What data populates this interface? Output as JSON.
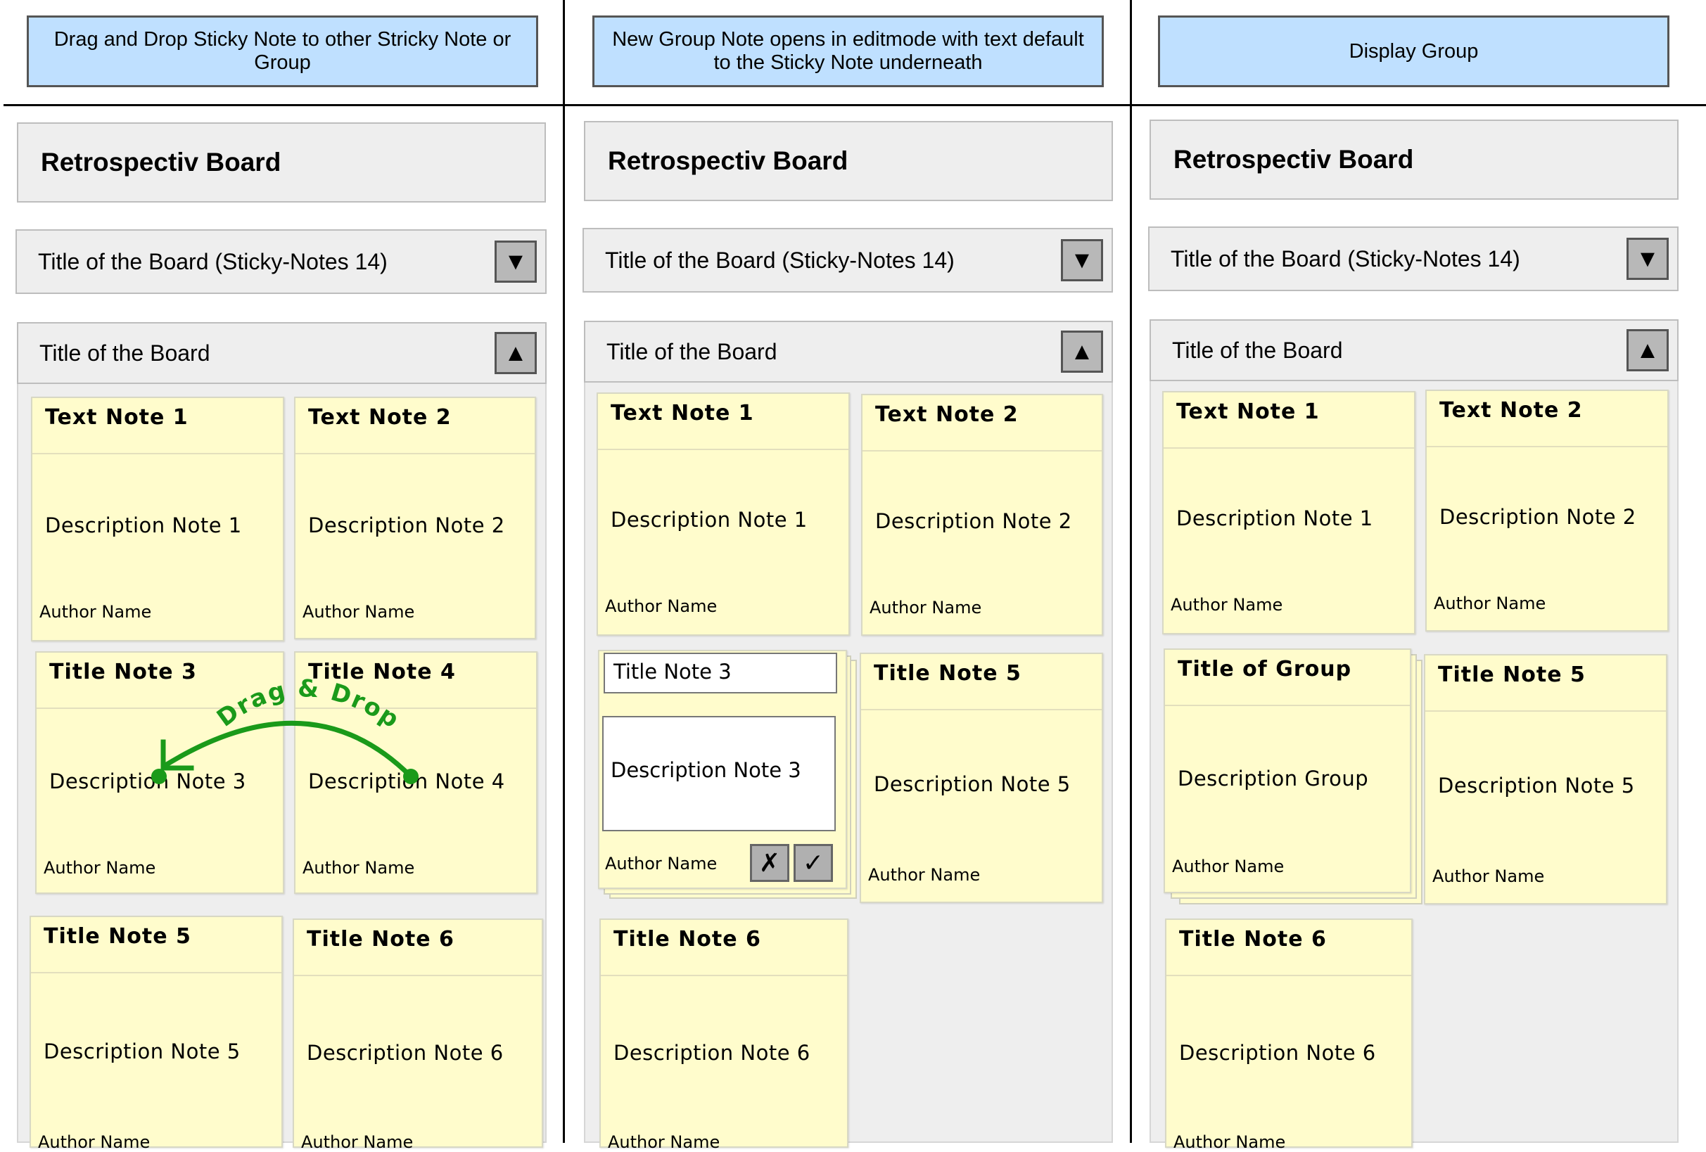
{
  "steps": [
    {
      "caption": "Drag and Drop Sticky Note to other Stricky Note or Group"
    },
    {
      "caption": "New Group Note opens in editmode with text default to the Sticky Note underneath"
    },
    {
      "caption": "Display Group"
    }
  ],
  "app": {
    "title": "Retrospectiv Board"
  },
  "board_collapsed": {
    "title": "Title of the Board (Sticky-Notes 14)",
    "toggle_icon": "▼"
  },
  "board_expanded": {
    "title": "Title of the Board",
    "toggle_icon": "▲"
  },
  "author": "Author Name",
  "panel1": {
    "notes": [
      {
        "title": "Text Note 1",
        "desc": "Description Note 1"
      },
      {
        "title": "Text Note 2",
        "desc": "Description Note 2"
      },
      {
        "title": "Title Note 3",
        "desc": "Description Note 3"
      },
      {
        "title": "Title Note 4",
        "desc": "Description Note 4"
      },
      {
        "title": "Title Note 5",
        "desc": "Description Note 5"
      },
      {
        "title": "Title Note 6",
        "desc": "Description Note 6"
      }
    ],
    "drag_label": "Drag & Drop"
  },
  "panel2": {
    "notes": [
      {
        "title": "Text Note 1",
        "desc": "Description Note 1"
      },
      {
        "title": "Text Note 2",
        "desc": "Description Note 2"
      },
      {
        "title": "Title Note 5",
        "desc": "Description Note 5"
      },
      {
        "title": "Title Note 6",
        "desc": "Description Note 6"
      }
    ],
    "edit_group": {
      "title_value": "Title Note 3",
      "desc_value": "Description Note 3",
      "cancel_icon": "✗",
      "confirm_icon": "✓"
    }
  },
  "panel3": {
    "notes": [
      {
        "title": "Text Note 1",
        "desc": "Description Note 1"
      },
      {
        "title": "Text Note 2",
        "desc": "Description Note 2"
      },
      {
        "title": "Title Note 5",
        "desc": "Description Note 5"
      },
      {
        "title": "Title Note 6",
        "desc": "Description Note 6"
      }
    ],
    "group": {
      "title": "Title of Group",
      "desc": "Description Group"
    }
  },
  "colors": {
    "drag_arrow": "#1a9a1a",
    "header_blue": "#bfe0ff",
    "note_yellow": "#fffccc"
  }
}
